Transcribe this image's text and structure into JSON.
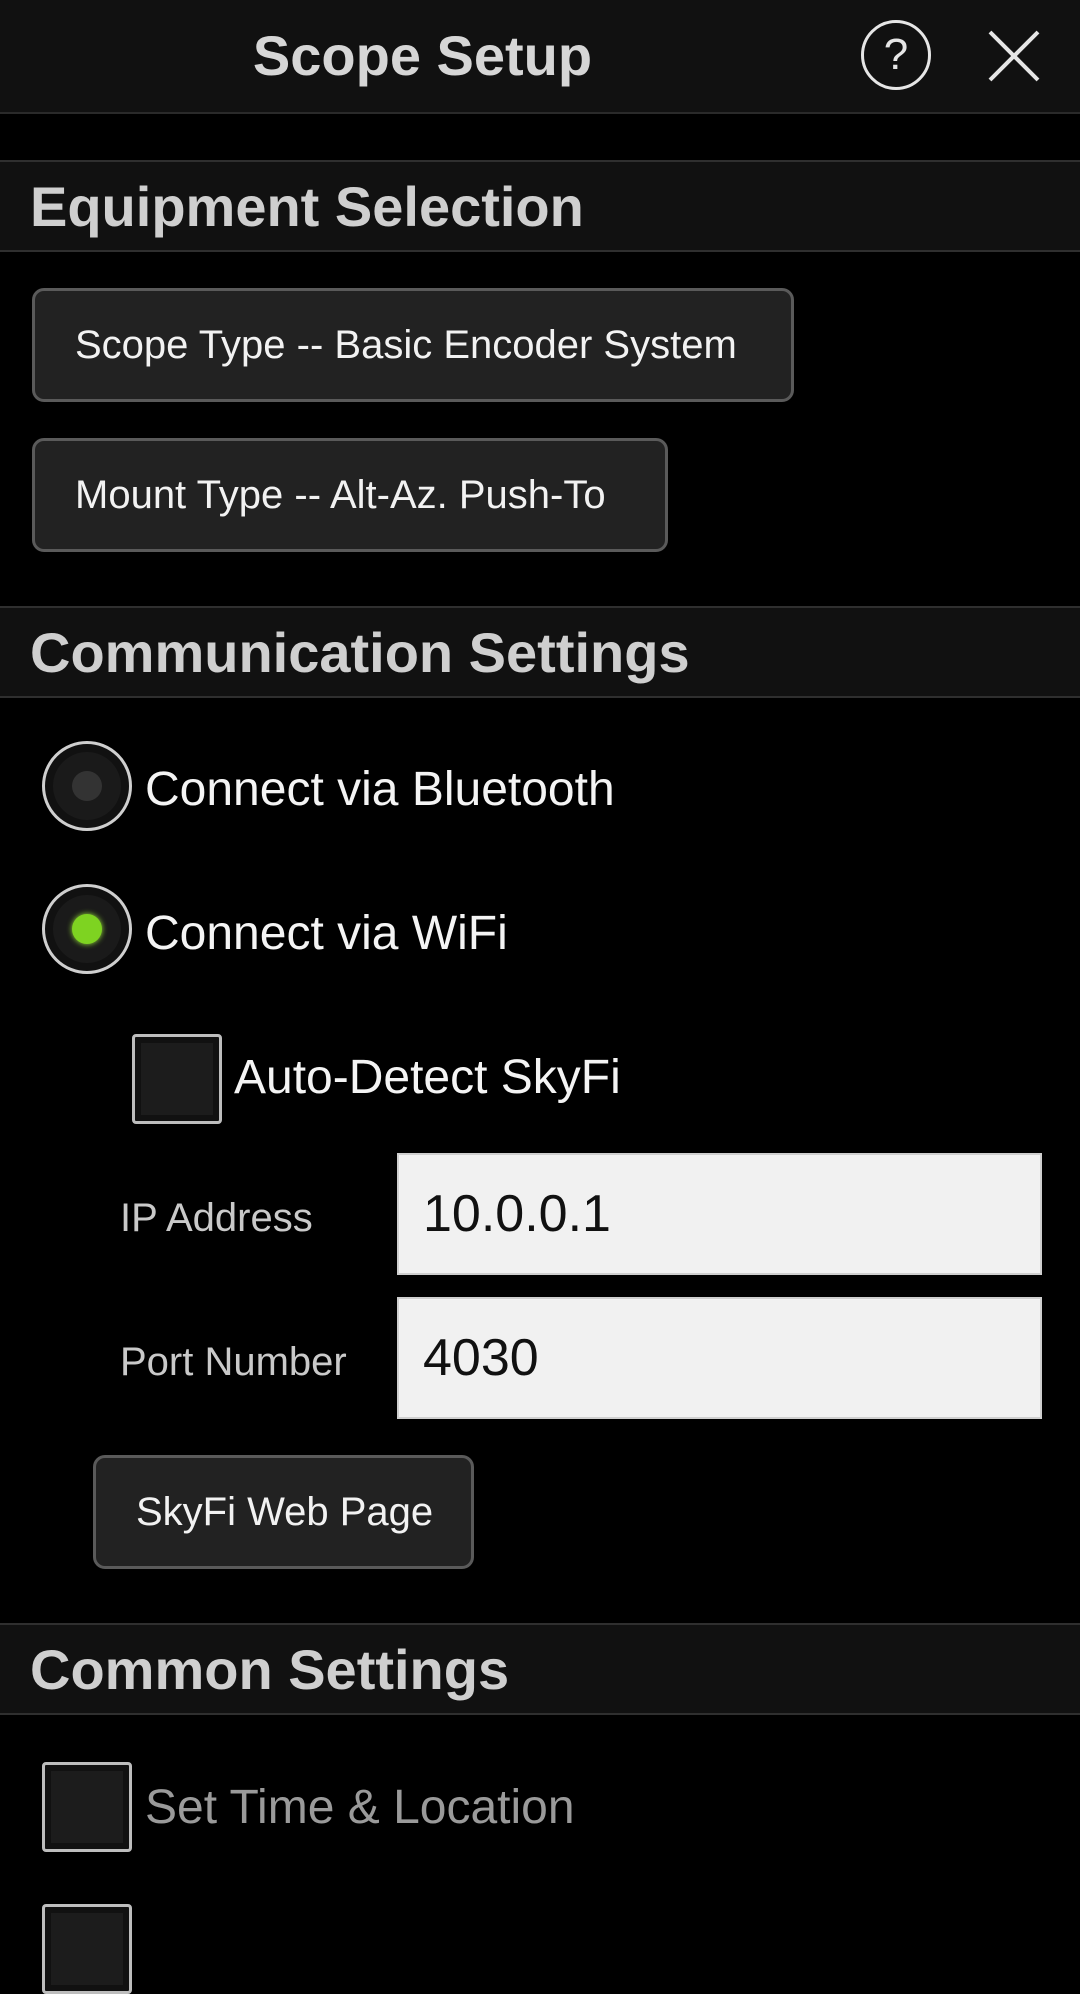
{
  "header": {
    "title": "Scope Setup",
    "help_label": "?",
    "help_icon": "question-circle-icon",
    "close_icon": "close-x-icon"
  },
  "equipment": {
    "title": "Equipment Selection",
    "scope_type_button": "Scope Type -- Basic Encoder System",
    "mount_type_button": "Mount Type -- Alt-Az. Push-To"
  },
  "communication": {
    "title": "Communication Settings",
    "bluetooth_label": "Connect via Bluetooth",
    "bluetooth_selected": false,
    "wifi_label": "Connect via WiFi",
    "wifi_selected": true,
    "auto_detect_label": "Auto-Detect SkyFi",
    "auto_detect_checked": false,
    "ip_label": "IP Address",
    "ip_value": "10.0.0.1",
    "port_label": "Port Number",
    "port_value": "4030",
    "web_page_button": "SkyFi Web Page"
  },
  "common": {
    "title": "Common Settings",
    "set_time_label": "Set Time & Location",
    "set_time_checked": false
  },
  "colors": {
    "radio_selected": "#7ed321",
    "background": "#000000",
    "header_bg": "#111111",
    "field_bg": "#f1f1f1"
  }
}
